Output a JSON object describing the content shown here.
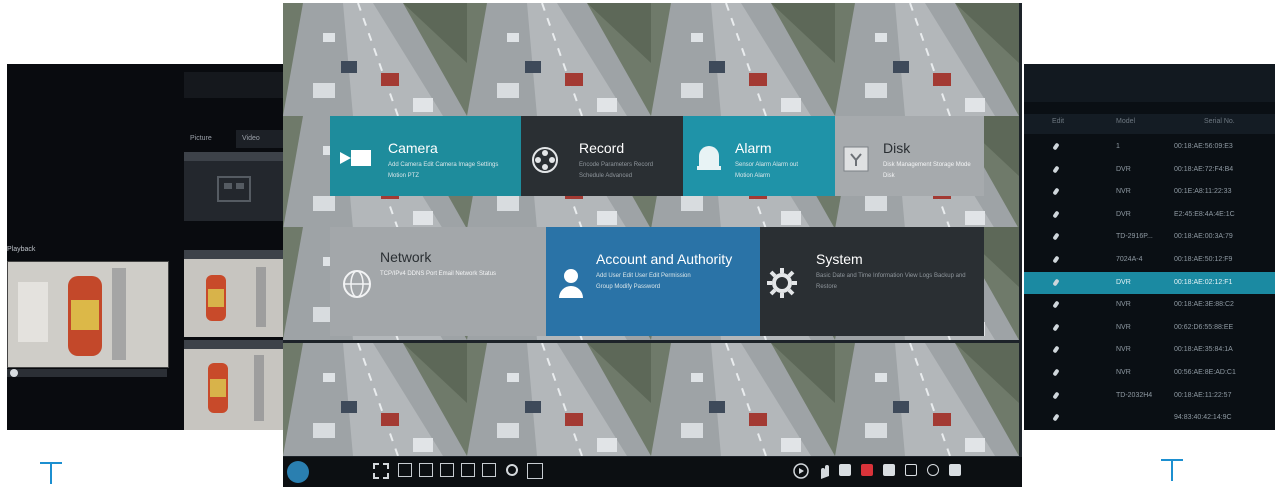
{
  "left_panel": {
    "tabs": [
      "Picture",
      "Video"
    ],
    "thumb_headers": [
      "",
      ""
    ],
    "playback_label": "Playback"
  },
  "right_panel": {
    "columns": [
      "Edit",
      "Model",
      "Serial No."
    ],
    "rows": [
      {
        "model": "1",
        "serial": "00:18:AE:56:09:E3"
      },
      {
        "model": "DVR",
        "serial": "00:18:AE:72:F4:B4"
      },
      {
        "model": "NVR",
        "serial": "00:1E:A8:11:22:33"
      },
      {
        "model": "DVR",
        "serial": "E2:45:E8:4A:4E:1C"
      },
      {
        "model": "TD-2916P...",
        "serial": "00:18:AE:00:3A:79"
      },
      {
        "model": "7024A-4",
        "serial": "00:18:AE:50:12:F9"
      },
      {
        "model": "DVR",
        "serial": "00:18:AE:02:12:F1"
      },
      {
        "model": "NVR",
        "serial": "00:18:AE:3E:88:C2"
      },
      {
        "model": "NVR",
        "serial": "00:62:D6:55:88:EE"
      },
      {
        "model": "NVR",
        "serial": "00:18:AE:35:84:1A"
      },
      {
        "model": "NVR",
        "serial": "00:56:AE:8E:AD:C1"
      },
      {
        "model": "TD-2032H4",
        "serial": "00:18:AE:11:22:57"
      },
      {
        "model": "",
        "serial": "94:83:40:42:14:9C"
      }
    ],
    "selected_index": 6
  },
  "menu": {
    "camera": {
      "title": "Camera",
      "sub": "Add Camera  Edit Camera  Image Settings  Motion  PTZ",
      "color": "#1e8c9c"
    },
    "record": {
      "title": "Record",
      "sub": "Encode Parameters  Record Schedule  Advanced",
      "color": "#2a2f33"
    },
    "alarm": {
      "title": "Alarm",
      "sub": "Sensor Alarm  Alarm out  Motion Alarm",
      "color": "#1f93a8"
    },
    "disk": {
      "title": "Disk",
      "sub": "Disk Management  Storage Mode  Disk",
      "color": "#a6aaad"
    },
    "network": {
      "title": "Network",
      "sub": "TCP/IPv4  DDNS  Port  Email  Network Status",
      "color": "#a3a7aa"
    },
    "account": {
      "title": "Account and Authority",
      "sub": "Add User  Edit User  Edit Permission Group  Modify Password",
      "color": "#2a73a7"
    },
    "system": {
      "title": "System",
      "sub": "Basic Date and Time Information  View Logs  Backup and Restore",
      "color": "#2a2f33"
    }
  },
  "icons": [
    "camera-icon",
    "film-reel-icon",
    "alarm-bell-icon",
    "disk-icon",
    "network-globe-icon",
    "user-icon",
    "gear-icon"
  ]
}
